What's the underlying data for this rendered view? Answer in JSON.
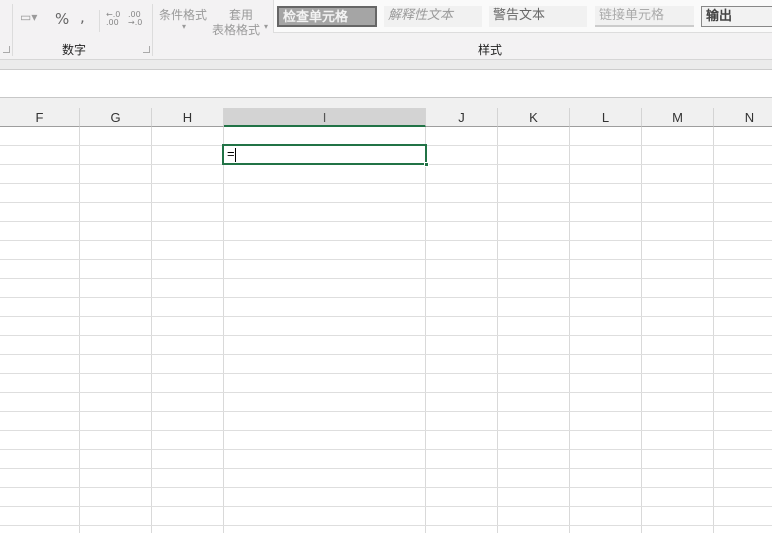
{
  "ribbon": {
    "number_group": {
      "label": "数字",
      "percent": "%",
      "comma": ",",
      "increase_decimal": "←.0 .00",
      "decrease_decimal": ".00 →.0"
    },
    "conditional_format": "条件格式",
    "table_format_line1": "套用",
    "table_format_line2": "表格格式",
    "styles_group": {
      "label": "样式",
      "items": [
        "检查单元格",
        "解释性文本",
        "警告文本",
        "链接单元格",
        "输出"
      ]
    }
  },
  "sheet": {
    "columns": [
      "F",
      "G",
      "H",
      "I",
      "J",
      "K",
      "L",
      "M",
      "N"
    ],
    "selected_column": "I",
    "active_cell_value": "="
  },
  "colors": {
    "accent": "#217346"
  }
}
